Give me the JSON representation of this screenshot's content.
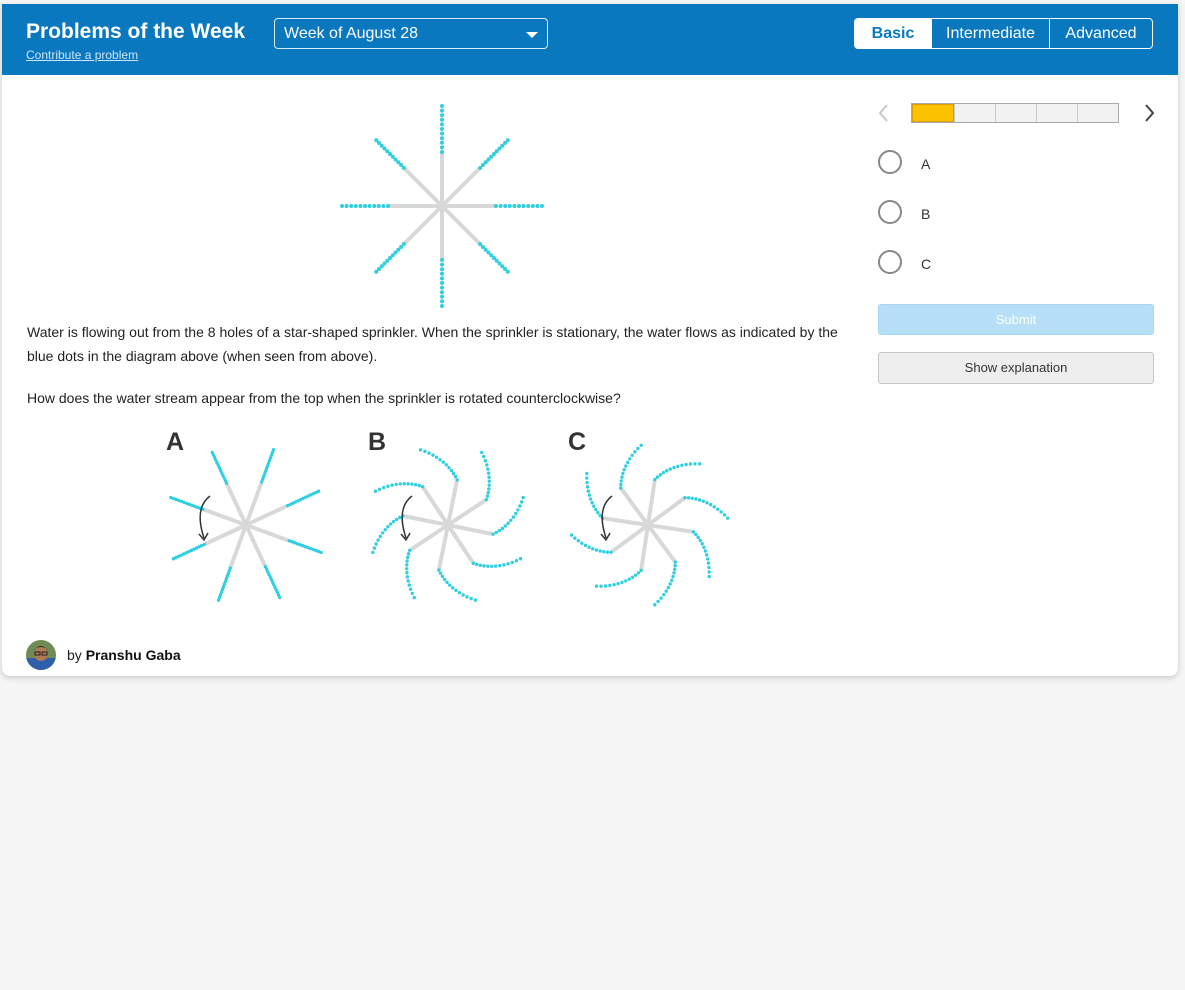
{
  "header": {
    "title": "Problems of the Week",
    "contribute_link": "Contribute a problem",
    "week_select": {
      "selected": "Week of August 28",
      "icon": "chevron-down-icon"
    },
    "levels": [
      {
        "label": "Basic",
        "active": true
      },
      {
        "label": "Intermediate",
        "active": false
      },
      {
        "label": "Advanced",
        "active": false
      }
    ],
    "brand_color": "#0a78bf"
  },
  "problem": {
    "text": "Water is flowing out from the 8 holes of a star-shaped sprinkler. When the sprinkler is stationary, the water flows as indicated by the blue dots in the diagram above (when seen from above).",
    "question": "How does the water stream appear from the top when the sprinkler is rotated counterclockwise?",
    "figure_options": [
      "A",
      "B",
      "C"
    ],
    "water_color": "#2dcfe0",
    "arm_color": "#d8d8d8"
  },
  "author": {
    "prefix": "by",
    "name": "Pranshu Gaba"
  },
  "sidebar": {
    "prev_icon": "chevron-left-icon",
    "next_icon": "chevron-right-icon",
    "progress": {
      "total": 5,
      "completed": 1,
      "completed_color": "#fcc200"
    },
    "choices": [
      {
        "label": "A",
        "selected": false
      },
      {
        "label": "B",
        "selected": false
      },
      {
        "label": "C",
        "selected": false
      }
    ],
    "submit_label": "Submit",
    "explanation_label": "Show explanation"
  }
}
